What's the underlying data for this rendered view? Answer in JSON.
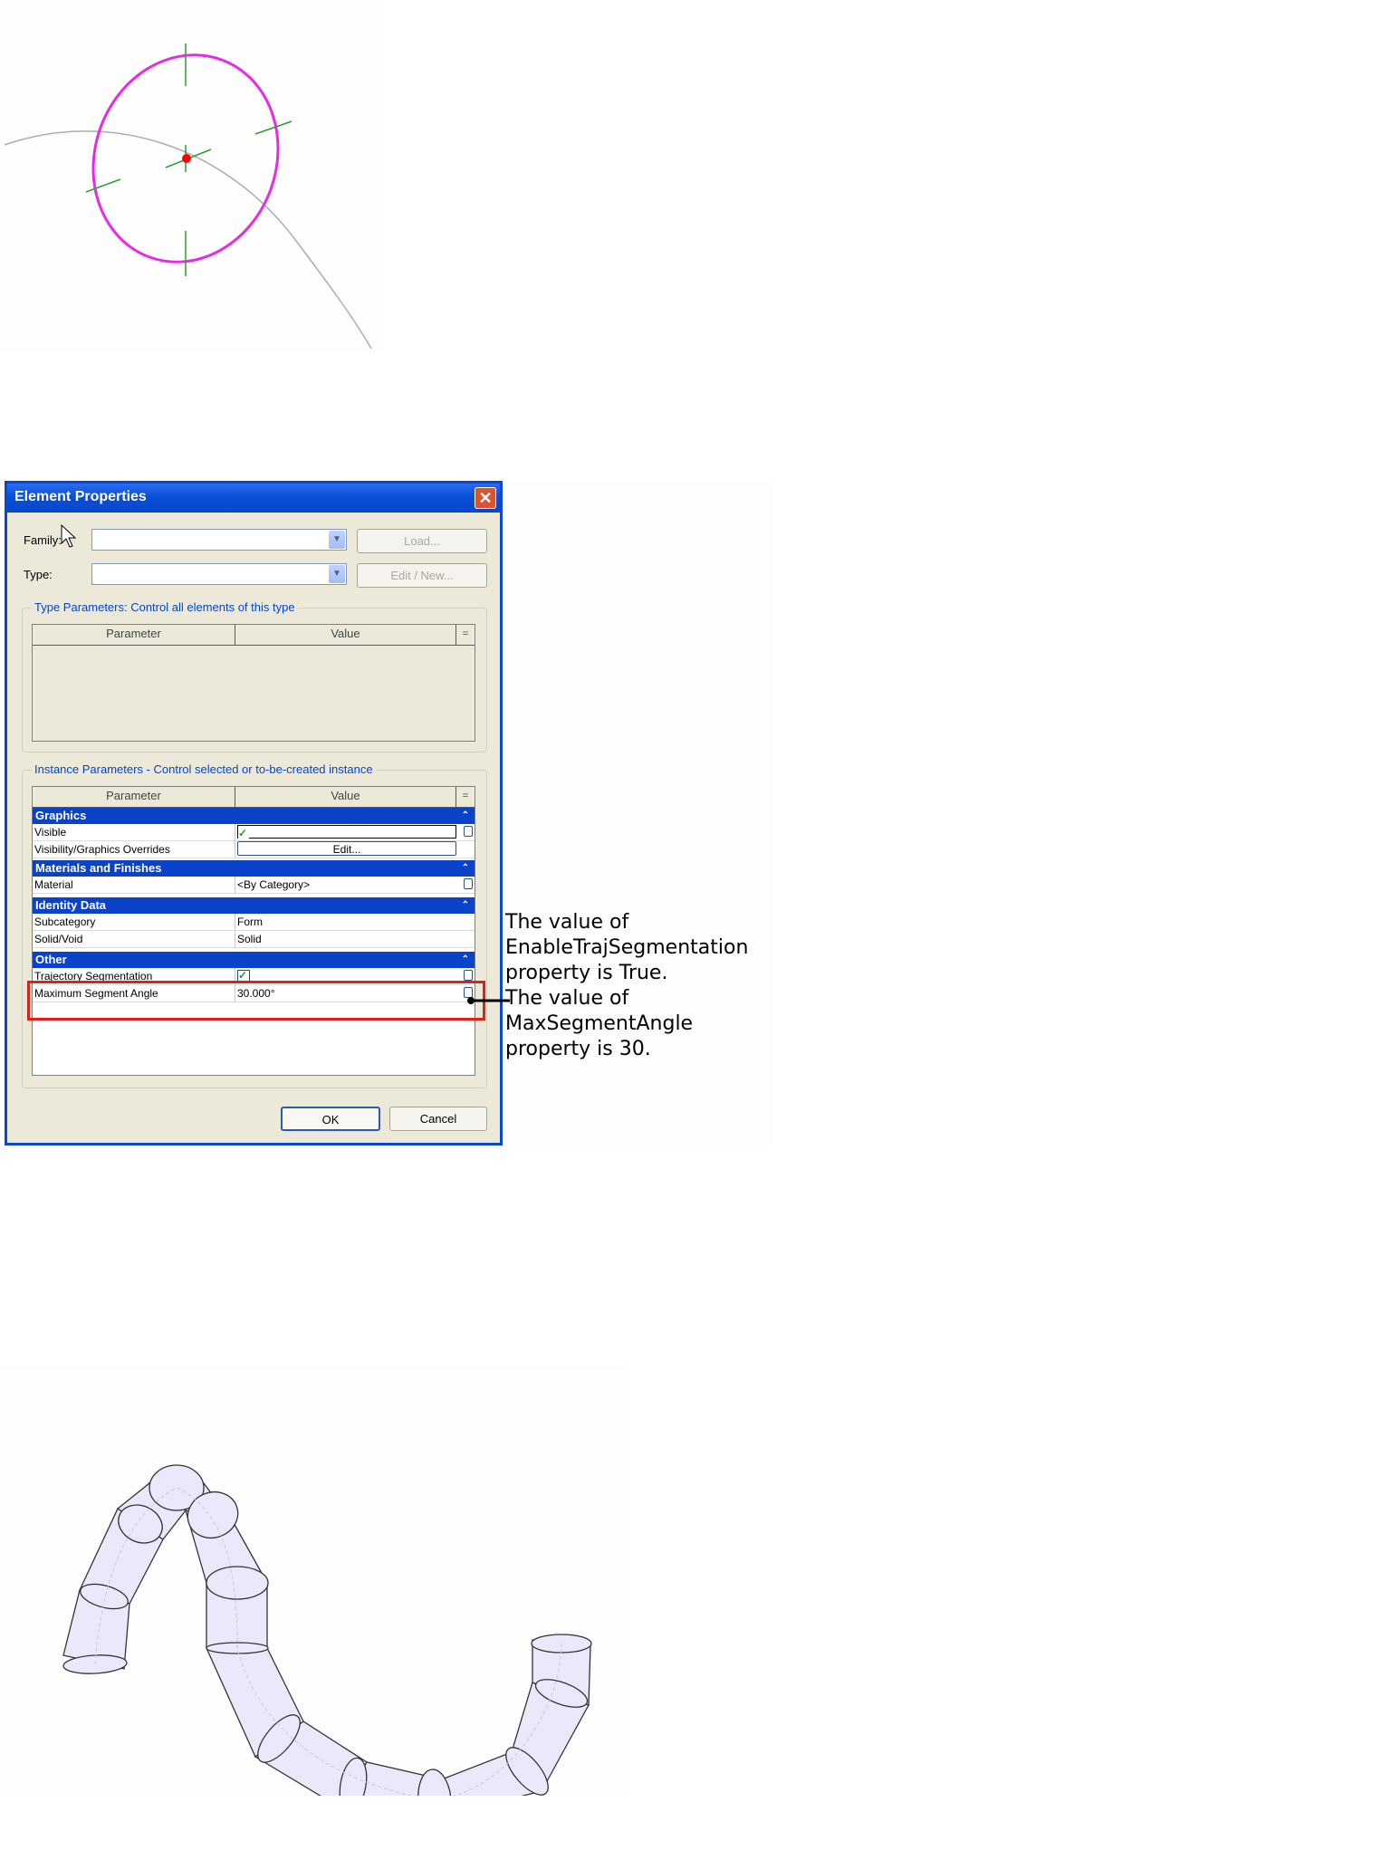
{
  "dialog": {
    "title": "Element Properties",
    "family_label": "Family:",
    "type_label": "Type:",
    "load_button": "Load...",
    "edit_new_button": "Edit / New...",
    "type_group_title": "Type Parameters: Control all elements of this type",
    "instance_group_title": "Instance Parameters - Control selected or to-be-created instance",
    "col_parameter": "Parameter",
    "col_value": "Value",
    "sections": {
      "graphics": "Graphics",
      "materials": "Materials and Finishes",
      "identity": "Identity Data",
      "other": "Other"
    },
    "rows": {
      "visible": "Visible",
      "vis_overrides": "Visibility/Graphics Overrides",
      "edit_button": "Edit...",
      "material": "Material",
      "material_value": "<By Category>",
      "subcategory": "Subcategory",
      "subcategory_value": "Form",
      "solid_void": "Solid/Void",
      "solid_void_value": "Solid",
      "traj_seg": "Trajectory Segmentation",
      "max_angle": "Maximum Segment Angle",
      "max_angle_value": "30.000°"
    },
    "ok_button": "OK",
    "cancel_button": "Cancel"
  },
  "annotation": {
    "text": "The value of\nEnableTrajSegmentation\nproperty is True.\nThe value of\nMaxSegmentAngle\nproperty is 30."
  },
  "colors": {
    "profile": "#e62ae6",
    "axis": "#2f9e2f",
    "point": "#ff0000",
    "pipe_fill": "#ece8fb",
    "highlight": "#e0201a"
  }
}
